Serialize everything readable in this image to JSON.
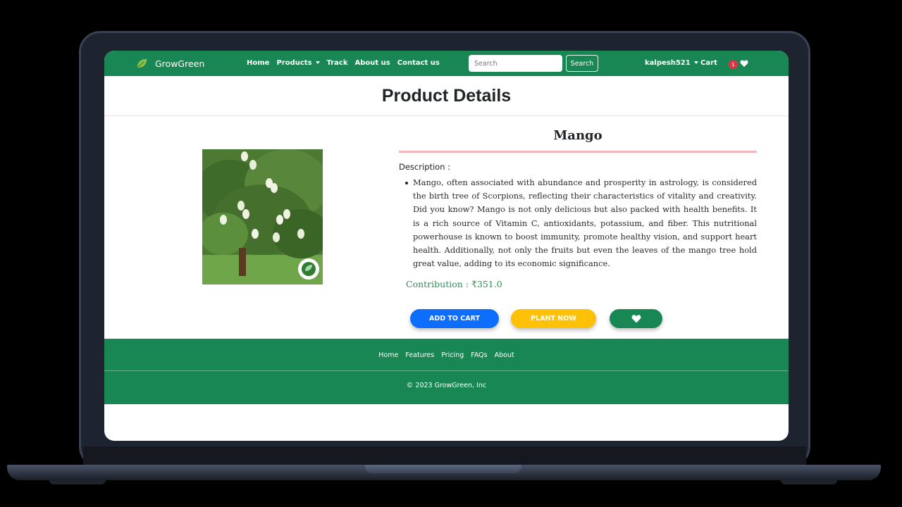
{
  "navbar": {
    "brand": "GrowGreen",
    "links": [
      "Home",
      "Products",
      "Track",
      "About us",
      "Contact us"
    ],
    "search_placeholder": "Search",
    "search_button": "Search",
    "username": "kalpesh521",
    "cart_label": "Cart",
    "cart_count": "1"
  },
  "page": {
    "title": "Product Details"
  },
  "product": {
    "name": "Mango",
    "description_label": "Description :",
    "description": "Mango, often associated with abundance and prosperity in astrology, is considered the birth tree of Scorpions, reflecting their characteristics of vitality and creativity. Did you know? Mango is not only delicious but also packed with health benefits. It is a rich source of Vitamin C, antioxidants, potassium, and fiber. This nutritional powerhouse is known to boost immunity, promote healthy vision, and support heart health. Additionally, not only the fruits but even the leaves of the mango tree hold great value, adding to its economic significance.",
    "contribution": "Contribution : ₹351.0"
  },
  "actions": {
    "add_to_cart": "ADD TO CART",
    "plant_now": "PLANT NOW"
  },
  "footer": {
    "links": [
      "Home",
      "Features",
      "Pricing",
      "FAQs",
      "About"
    ],
    "copyright": "© 2023 GrowGreen, Inc"
  },
  "colors": {
    "brand_green": "#198754",
    "primary_blue": "#0d6efd",
    "warning_yellow": "#ffc107",
    "badge_red": "#dc3545"
  },
  "icons": [
    "leaf-icon",
    "caret-down-icon",
    "heart-icon",
    "eco-badge-icon"
  ]
}
